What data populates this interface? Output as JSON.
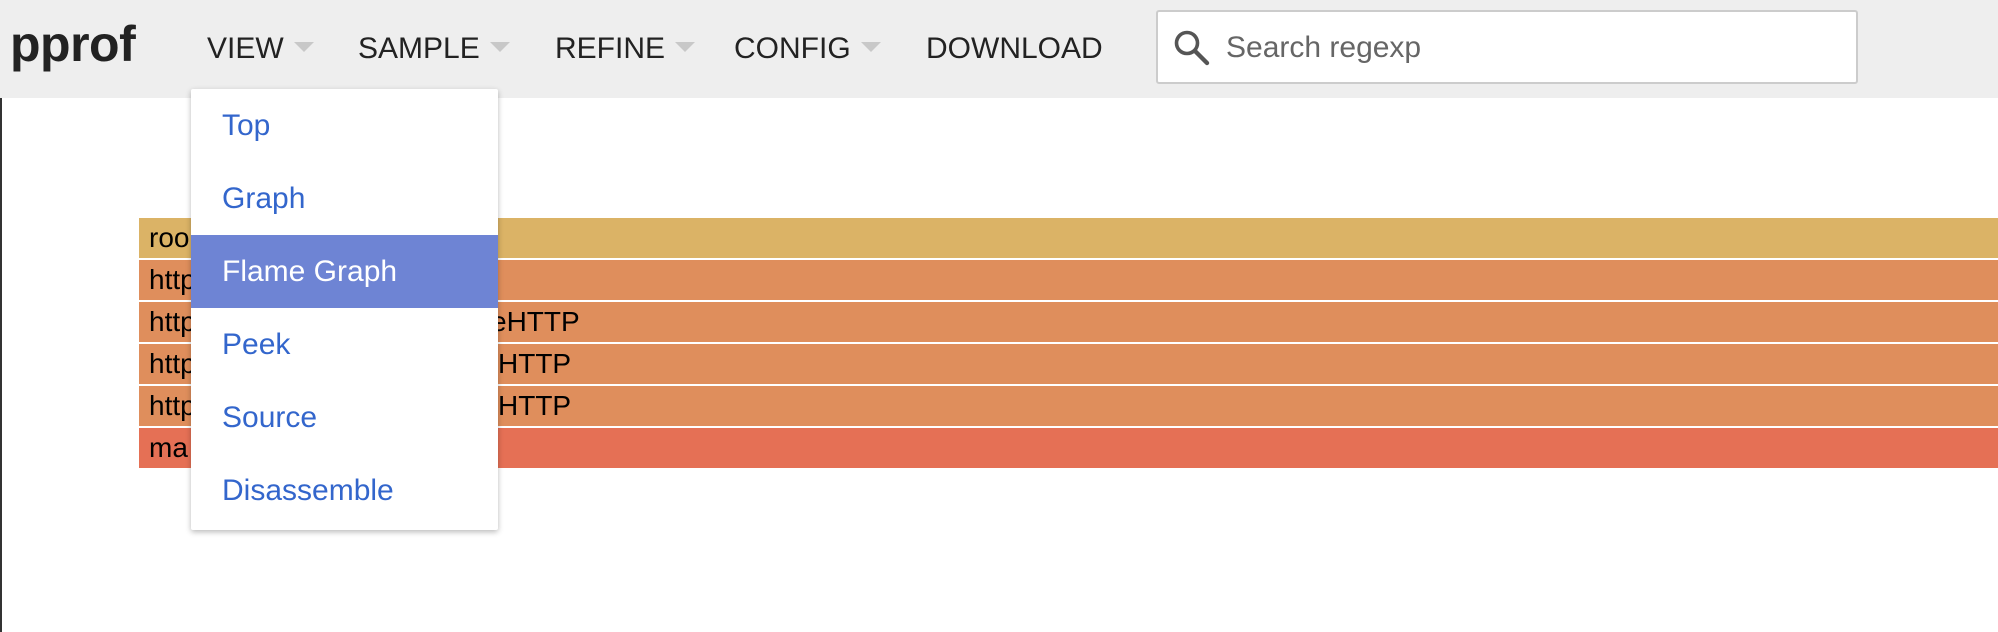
{
  "app": {
    "logo": "pprof"
  },
  "menu": {
    "view": "VIEW",
    "sample": "SAMPLE",
    "refine": "REFINE",
    "config": "CONFIG",
    "download": "DOWNLOAD"
  },
  "search": {
    "placeholder": "Search regexp",
    "value": ""
  },
  "view_dropdown": {
    "items": [
      "Top",
      "Graph",
      "Flame Graph",
      "Peek",
      "Source",
      "Disassemble"
    ],
    "selected": "Flame Graph"
  },
  "flame_graph": {
    "frames": [
      {
        "visible_left": "roo",
        "visible_right": "",
        "color": "#dbb366"
      },
      {
        "visible_left": "http",
        "visible_right": "",
        "color": "#df8e5c"
      },
      {
        "visible_left": "http",
        "visible_right": "eHTTP",
        "color": "#df8e5c"
      },
      {
        "visible_left": "http",
        "visible_right": "HTTP",
        "color": "#df8e5c"
      },
      {
        "visible_left": "http",
        "visible_right": "HTTP",
        "color": "#df8e5c"
      },
      {
        "visible_left": "ma",
        "visible_right": "",
        "color": "#e57055"
      }
    ]
  },
  "colors": {
    "header_bg": "#eeeeee",
    "link": "#3366cc",
    "selected_bg": "#6e84d4"
  }
}
